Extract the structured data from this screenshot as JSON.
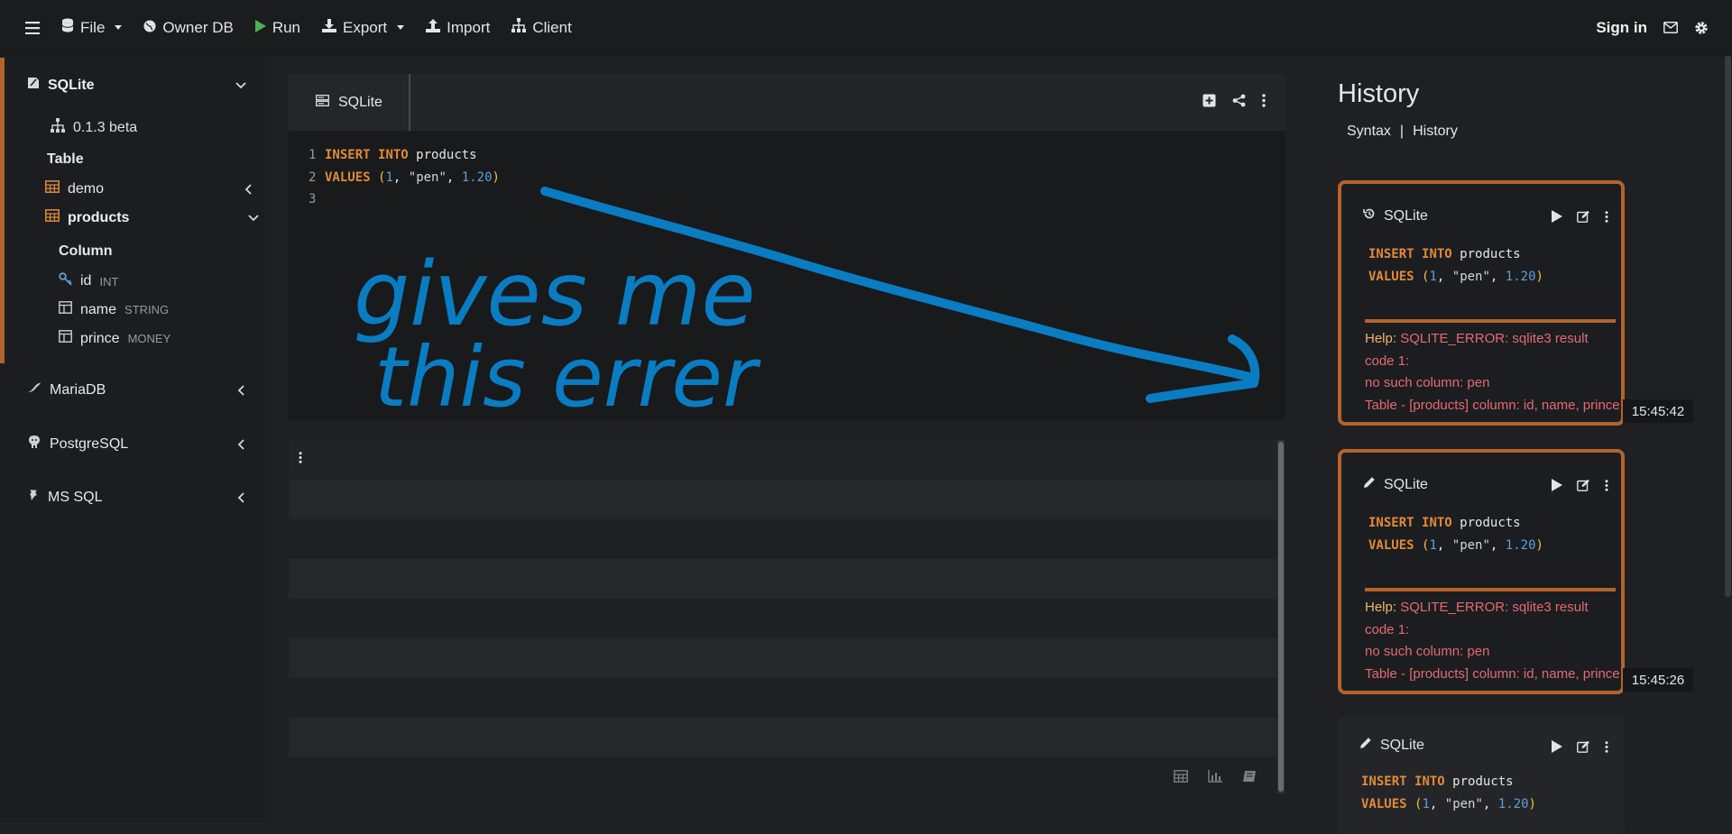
{
  "topbar": {
    "file": "File",
    "owner_db": "Owner DB",
    "run": "Run",
    "export": "Export",
    "import": "Import",
    "client": "Client",
    "sign_in": "Sign in"
  },
  "sidebar": {
    "sqlite": "SQLite",
    "version": "0.1.3 beta",
    "table_heading": "Table",
    "tables": [
      "demo",
      "products"
    ],
    "column_heading": "Column",
    "columns": [
      {
        "name": "id",
        "type": "INT"
      },
      {
        "name": "name",
        "type": "STRING"
      },
      {
        "name": "prince",
        "type": "MONEY"
      }
    ],
    "databases": [
      "MariaDB",
      "PostgreSQL",
      "MS SQL"
    ]
  },
  "editor": {
    "tab_label": "SQLite",
    "lines": {
      "l1": {
        "no": "1",
        "kw1": "INSERT",
        "kw2": "INTO",
        "ident": "products"
      },
      "l2": {
        "no": "2",
        "kw": "VALUES",
        "open": "(",
        "n1": "1",
        "c1": ",",
        "s": "\"pen\"",
        "c2": ",",
        "n2": "1.20",
        "close": ")"
      },
      "l3": {
        "no": "3"
      }
    }
  },
  "annotation": {
    "text_line1": "gives me",
    "text_line2": "this errer",
    "color": "#0a7cc2"
  },
  "history": {
    "title": "History",
    "nav_syntax": "Syntax",
    "nav_sep": "|",
    "nav_history": "History",
    "entries": [
      {
        "db": "SQLite",
        "help_label": "Help:",
        "error_1": "SQLITE_ERROR: sqlite3 result code 1:",
        "error_2": "no such column: pen",
        "error_3": "Table - [products] column: id, name, prince",
        "time": "15:45:42"
      },
      {
        "db": "SQLite",
        "help_label": "Help:",
        "error_1": "SQLITE_ERROR: sqlite3 result code 1:",
        "error_2": "no such column: pen",
        "error_3": "Table - [products] column: id, name, prince",
        "time": "15:45:26"
      },
      {
        "db": "SQLite"
      }
    ],
    "code": {
      "kw1": "INSERT",
      "kw2": "INTO",
      "ident": "products",
      "kw3": "VALUES",
      "open": "(",
      "n1": "1",
      "c1": ",",
      "s": "\"pen\"",
      "c2": ",",
      "n2": "1.20",
      "close": ")"
    }
  },
  "colors": {
    "accent": "#b2642a",
    "keyword": "#e08a3a",
    "number": "#5f9fd6",
    "error": "#e26b73",
    "help": "#f0b36a",
    "run_icon": "#4caf50"
  }
}
